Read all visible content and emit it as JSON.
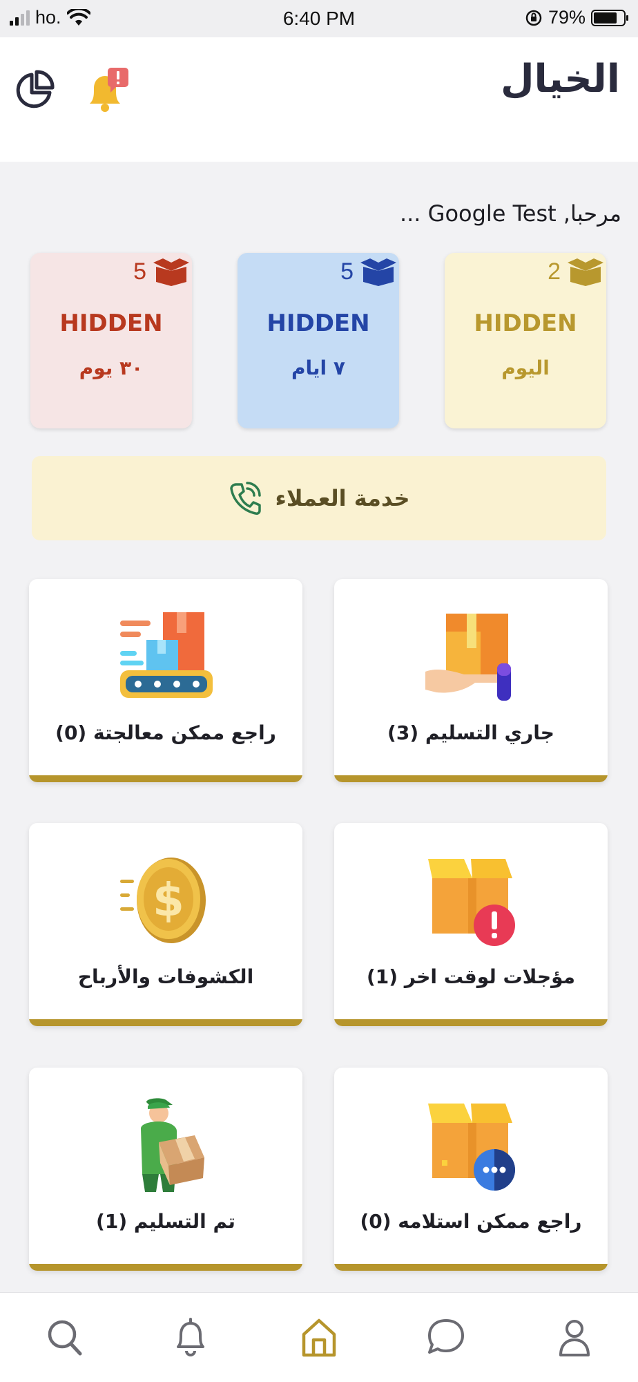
{
  "status_bar": {
    "carrier": "ho.",
    "time": "6:40 PM",
    "battery": "79%",
    "battery_level": 0.79
  },
  "header": {
    "title": "الخيال",
    "icons": [
      "chart-icon",
      "notification-bell-icon"
    ]
  },
  "greeting": "مرحبا, Google Test ...",
  "stats": [
    {
      "count": "2",
      "label": "HIDDEN",
      "period": "اليوم",
      "color": "#b8982e",
      "bg": "#faf3d4",
      "icon": "box-icon"
    },
    {
      "count": "5",
      "label": "HIDDEN",
      "period": "٧ ايام",
      "color": "#2445a6",
      "bg": "#c5dcf5",
      "icon": "box-icon"
    },
    {
      "count": "5",
      "label": "HIDDEN",
      "period": "٣٠ يوم",
      "color": "#b8391f",
      "bg": "#f6e5e5",
      "icon": "box-icon"
    }
  ],
  "customer_service": {
    "label": "خدمة العملاء",
    "icon": "phone-icon"
  },
  "tiles": [
    {
      "label": "جاري التسليم (3)",
      "icon": "package-in-hand-icon"
    },
    {
      "label": "راجع ممكن معالجتة (0)",
      "icon": "conveyor-boxes-icon"
    },
    {
      "label": "مؤجلات لوقت اخر (1)",
      "icon": "box-alert-icon"
    },
    {
      "label": "الكشوفات والأرباح",
      "icon": "dollar-coin-icon"
    },
    {
      "label": "راجع ممكن استلامه (0)",
      "icon": "box-message-icon"
    },
    {
      "label": "تم التسليم (1)",
      "icon": "delivery-man-icon"
    }
  ],
  "bottom_nav": [
    "search-icon",
    "bell-icon",
    "home-icon",
    "chat-icon",
    "profile-icon"
  ],
  "colors": {
    "accent": "#b6952c",
    "title": "#2a2b3d"
  }
}
